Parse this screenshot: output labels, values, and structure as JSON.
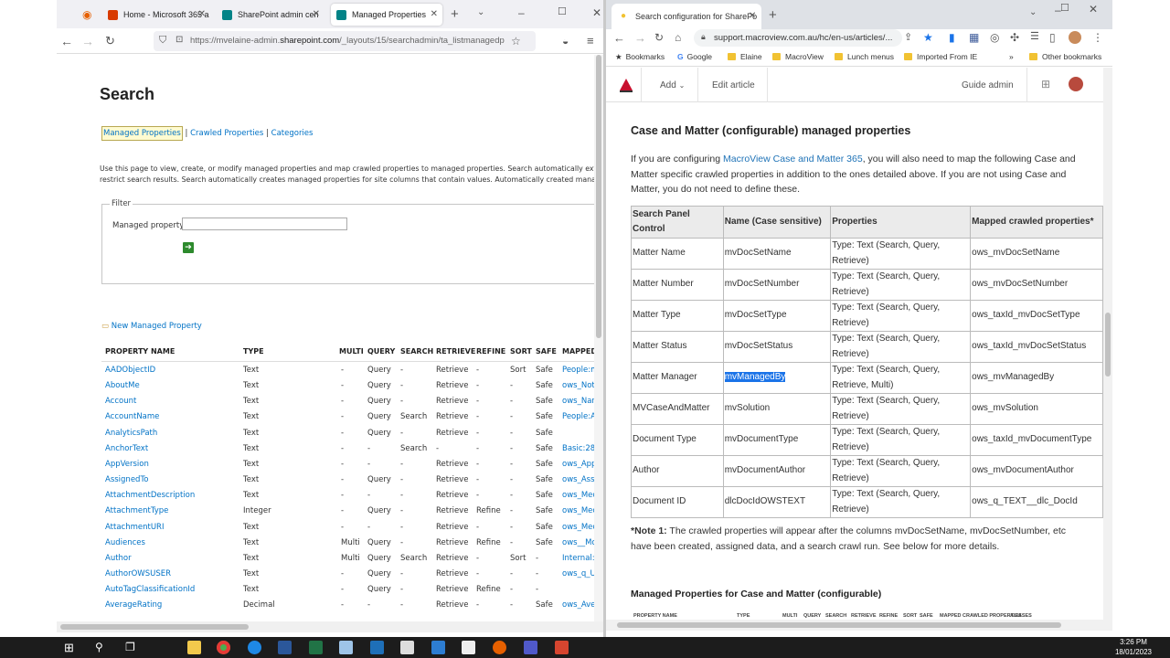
{
  "left_browser": {
    "tabs": [
      {
        "label": "Home - Microsoft 365 a",
        "color": "#d83b01"
      },
      {
        "label": "SharePoint admin cen",
        "color": "#038387"
      },
      {
        "label": "Managed Properties",
        "color": "#038387"
      }
    ],
    "url_prefix": "https://mvelaine-admin.",
    "url_host": "sharepoint.com",
    "url_suffix": "/_layouts/15/searchadmin/ta_listmanagedp"
  },
  "sp": {
    "title": "Search",
    "links": {
      "managed": "Managed Properties",
      "sep": "|",
      "crawled": "Crawled Properties",
      "categories": "Categories"
    },
    "desc_line1": "Use this page to view, create, or modify managed properties and map crawled properties to managed properties. Search automatically extra",
    "desc_line2": "restrict search results. Search automatically creates managed properties for site columns that contain values. Automatically created manage",
    "filter_legend": "Filter",
    "filter_label": "Managed property",
    "new_link": "New Managed Property",
    "headers": [
      "PROPERTY NAME",
      "TYPE",
      "MULTI",
      "QUERY",
      "SEARCH",
      "RETRIEVE",
      "REFINE",
      "SORT",
      "SAFE",
      "MAPPED"
    ],
    "rows": [
      {
        "n": "AADObjectID",
        "t": "Text",
        "m": "-",
        "q": "Query",
        "s": "-",
        "r": "Retrieve",
        "f": "-",
        "o": "Sort",
        "a": "Safe",
        "p": "People:m"
      },
      {
        "n": "AboutMe",
        "t": "Text",
        "m": "-",
        "q": "Query",
        "s": "-",
        "r": "Retrieve",
        "f": "-",
        "o": "-",
        "a": "Safe",
        "p": "ows_Not"
      },
      {
        "n": "Account",
        "t": "Text",
        "m": "-",
        "q": "Query",
        "s": "-",
        "r": "Retrieve",
        "f": "-",
        "o": "-",
        "a": "Safe",
        "p": "ows_Nar"
      },
      {
        "n": "AccountName",
        "t": "Text",
        "m": "-",
        "q": "Query",
        "s": "Search",
        "r": "Retrieve",
        "f": "-",
        "o": "-",
        "a": "Safe",
        "p": "People:A"
      },
      {
        "n": "AnalyticsPath",
        "t": "Text",
        "m": "-",
        "q": "Query",
        "s": "-",
        "r": "Retrieve",
        "f": "-",
        "o": "-",
        "a": "Safe",
        "p": ""
      },
      {
        "n": "AnchorText",
        "t": "Text",
        "m": "-",
        "q": "-",
        "s": "Search",
        "r": "-",
        "f": "-",
        "o": "-",
        "a": "Safe",
        "p": "Basic:28"
      },
      {
        "n": "AppVersion",
        "t": "Text",
        "m": "-",
        "q": "-",
        "s": "-",
        "r": "Retrieve",
        "f": "-",
        "o": "-",
        "a": "Safe",
        "p": "ows_App"
      },
      {
        "n": "AssignedTo",
        "t": "Text",
        "m": "-",
        "q": "Query",
        "s": "-",
        "r": "Retrieve",
        "f": "-",
        "o": "-",
        "a": "Safe",
        "p": "ows_Assi"
      },
      {
        "n": "AttachmentDescription",
        "t": "Text",
        "m": "-",
        "q": "-",
        "s": "-",
        "r": "Retrieve",
        "f": "-",
        "o": "-",
        "a": "Safe",
        "p": "ows_Mec"
      },
      {
        "n": "AttachmentType",
        "t": "Integer",
        "m": "-",
        "q": "Query",
        "s": "-",
        "r": "Retrieve",
        "f": "Refine",
        "o": "-",
        "a": "Safe",
        "p": "ows_Mec"
      },
      {
        "n": "AttachmentURI",
        "t": "Text",
        "m": "-",
        "q": "-",
        "s": "-",
        "r": "Retrieve",
        "f": "-",
        "o": "-",
        "a": "Safe",
        "p": "ows_Mec"
      },
      {
        "n": "Audiences",
        "t": "Text",
        "m": "Multi",
        "q": "Query",
        "s": "-",
        "r": "Retrieve",
        "f": "Refine",
        "o": "-",
        "a": "Safe",
        "p": "ows__Mc"
      },
      {
        "n": "Author",
        "t": "Text",
        "m": "Multi",
        "q": "Query",
        "s": "Search",
        "r": "Retrieve",
        "f": "-",
        "o": "Sort",
        "a": "-",
        "p": "Internal:"
      },
      {
        "n": "AuthorOWSUSER",
        "t": "Text",
        "m": "-",
        "q": "Query",
        "s": "-",
        "r": "Retrieve",
        "f": "-",
        "o": "-",
        "a": "-",
        "p": "ows_q_U"
      },
      {
        "n": "AutoTagClassificationId",
        "t": "Text",
        "m": "-",
        "q": "Query",
        "s": "-",
        "r": "Retrieve",
        "f": "Refine",
        "o": "-",
        "a": "-",
        "p": ""
      },
      {
        "n": "AverageRating",
        "t": "Decimal",
        "m": "-",
        "q": "-",
        "s": "-",
        "r": "Retrieve",
        "f": "-",
        "o": "-",
        "a": "Safe",
        "p": "ows_Ave"
      }
    ]
  },
  "right_browser": {
    "tab_label": "Search configuration for SharePo",
    "url": "support.macroview.com.au/hc/en-us/articles/...",
    "bookmarks": [
      "Bookmarks",
      "Google",
      "Elaine",
      "MacroView",
      "Lunch menus",
      "Imported From IE",
      "Other bookmarks"
    ],
    "zd_add": "Add",
    "zd_edit": "Edit article",
    "zd_guide": "Guide admin"
  },
  "article": {
    "heading": "Case and Matter (configurable) managed properties",
    "intro_a": "If you are configuring ",
    "intro_link": "MacroView Case and Matter 365",
    "intro_b": ", you will also need to map the following Case and Matter specific crawled properties in addition to the ones detailed above. If you are not using Case and Matter, you do not need to define these.",
    "table_headers": [
      "Search Panel Control",
      "Name (Case sensitive)",
      "Properties",
      "Mapped crawled properties*"
    ],
    "table_rows": [
      {
        "c": "Matter Name",
        "n": "mvDocSetName",
        "p": "Type: Text (Search, Query, Retrieve)",
        "m": "ows_mvDocSetName"
      },
      {
        "c": "Matter Number",
        "n": "mvDocSetNumber",
        "p": "Type: Text (Search, Query, Retrieve)",
        "m": "ows_mvDocSetNumber"
      },
      {
        "c": "Matter Type",
        "n": "mvDocSetType",
        "p": "Type: Text (Search, Query, Retrieve)",
        "m": "ows_taxId_mvDocSetType"
      },
      {
        "c": "Matter Status",
        "n": "mvDocSetStatus",
        "p": "Type: Text (Search, Query, Retrieve)",
        "m": "ows_taxId_mvDocSetStatus"
      },
      {
        "c": "Matter Manager",
        "n": "mvManagedBy",
        "p": "Type: Text (Search, Query, Retrieve, Multi)",
        "m": "ows_mvManagedBy"
      },
      {
        "c": "MVCaseAndMatter",
        "n": "mvSolution",
        "p": "Type: Text (Search, Query, Retrieve)",
        "m": "ows_mvSolution"
      },
      {
        "c": "Document Type",
        "n": "mvDocumentType",
        "p": "Type: Text (Search, Query, Retrieve)",
        "m": "ows_taxId_mvDocumentType"
      },
      {
        "c": "Author",
        "n": "mvDocumentAuthor",
        "p": "Type: Text (Search, Query, Retrieve)",
        "m": "ows_mvDocumentAuthor"
      },
      {
        "c": "Document ID",
        "n": "dlcDocIdOWSTEXT",
        "p": "Type: Text (Search, Query, Retrieve)",
        "m": "ows_q_TEXT__dlc_DocId"
      }
    ],
    "note_label": "*Note 1:",
    "note_text": " The crawled properties will appear after the columns mvDocSetName, mvDocSetNumber, etc have been created, assigned data, and a search crawl run.  See below for more details.",
    "heading2": "Managed Properties for Case and Matter (configurable)",
    "mini_headers": [
      "PROPERTY NAME",
      "TYPE",
      "MULTI",
      "QUERY",
      "SEARCH",
      "RETRIEVE",
      "REFINE",
      "SORT",
      "SAFE",
      "MAPPED CRAWLED PROPERTIES",
      "ALIASES"
    ]
  },
  "taskbar": {
    "time": "3:26 PM",
    "date": "18/01/2023"
  }
}
